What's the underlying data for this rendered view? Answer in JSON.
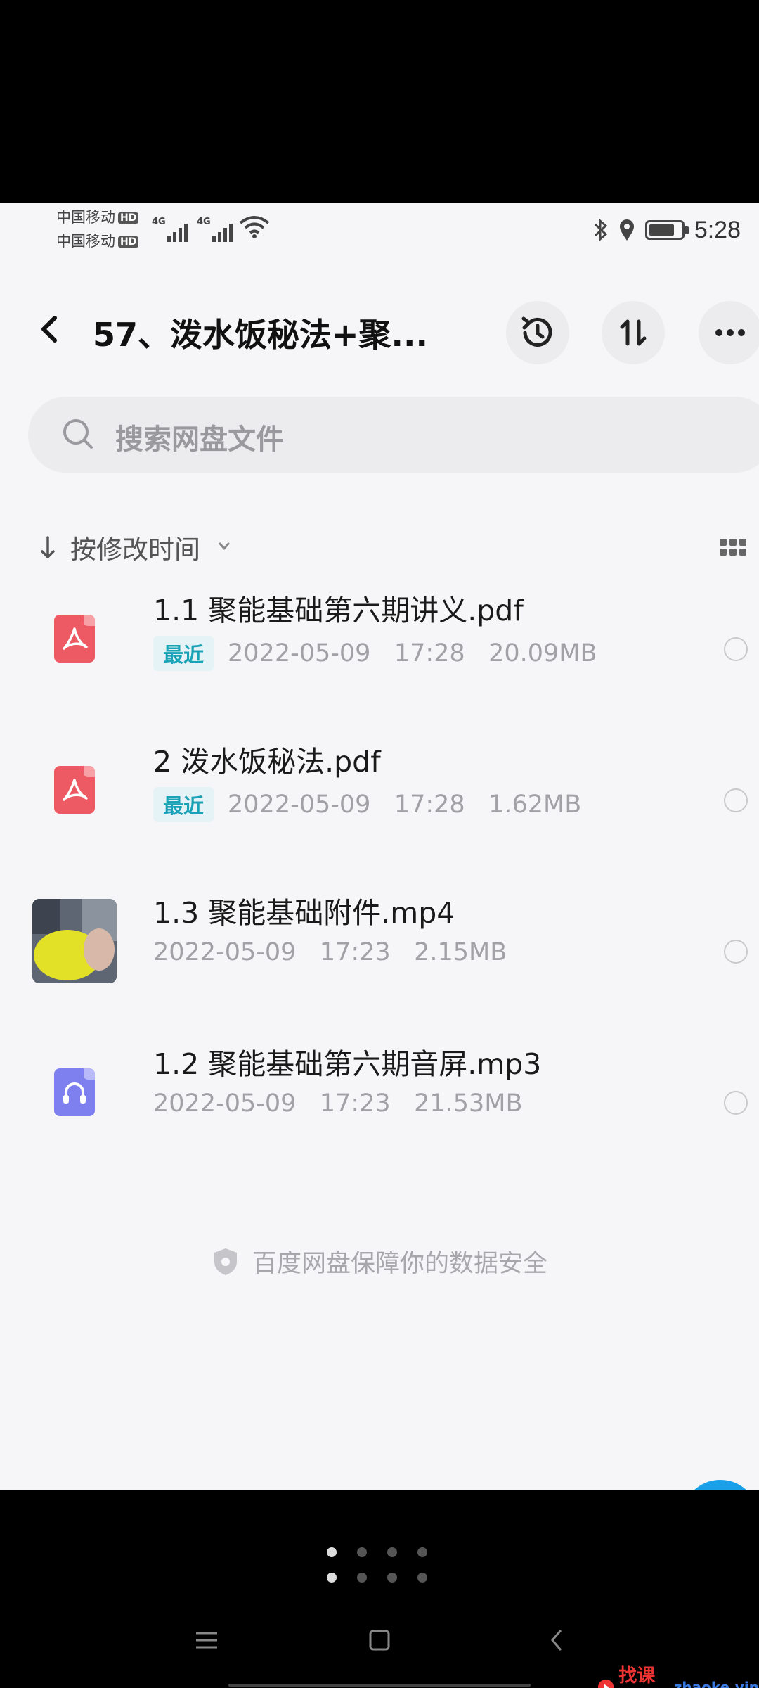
{
  "status_bar": {
    "carrier1": "中国移动",
    "carrier2": "中国移动",
    "hd_badge": "HD",
    "signal1_label": "4G",
    "signal2_label": "4G",
    "time": "5:28"
  },
  "header": {
    "title": "57、泼水饭秘法+聚...",
    "back_icon": "chevron-left-icon",
    "history_icon": "history-icon",
    "sort_toggle_icon": "swap-vertical-icon",
    "more_icon": "more-horizontal-icon"
  },
  "search": {
    "placeholder": "搜索网盘文件"
  },
  "sort": {
    "label": "按修改时间"
  },
  "files": [
    {
      "name": "1.1 聚能基础第六期讲义.pdf",
      "tag": "最近",
      "date": "2022-05-09",
      "time": "17:28",
      "size": "20.09MB",
      "icon": "pdf-icon"
    },
    {
      "name": "2 泼水饭秘法.pdf",
      "tag": "最近",
      "date": "2022-05-09",
      "time": "17:28",
      "size": "1.62MB",
      "icon": "pdf-icon"
    },
    {
      "name": "1.3 聚能基础附件.mp4",
      "tag": "",
      "date": "2022-05-09",
      "time": "17:23",
      "size": "2.15MB",
      "icon": "video-thumbnail"
    },
    {
      "name": "1.2 聚能基础第六期音屏.mp3",
      "tag": "",
      "date": "2022-05-09",
      "time": "17:23",
      "size": "21.53MB",
      "icon": "audio-icon"
    }
  ],
  "footer": {
    "note": "百度网盘保障你的数据安全"
  },
  "watermark": {
    "text": "找课网",
    "site": "zhaoke.vip"
  },
  "colors": {
    "pdf": "#ee5a63",
    "audio": "#7e80f0",
    "tag_text": "#1aa3b6",
    "background": "#f6f6f8"
  }
}
